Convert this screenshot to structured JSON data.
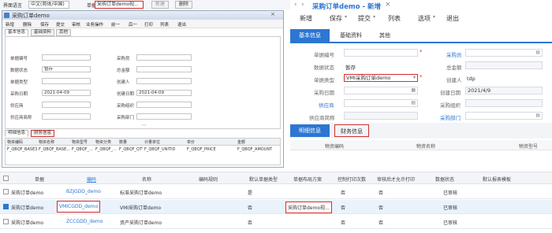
{
  "topbar": {
    "lang_label": "界面语言",
    "lang_value": "中文(简体/中国)",
    "template_label": "单据",
    "template_value": "采购订单demo视...",
    "new_btn": "新建",
    "delete_btn": "删除"
  },
  "oldwin": {
    "title": "采购订单demo",
    "toolbar": [
      "新增",
      "删除",
      "保存",
      "提交",
      "审核",
      "业务操作",
      "前一",
      "后一",
      "打印",
      "列表",
      "退出"
    ],
    "tabs": [
      "基本信息",
      "基础资料",
      "其他"
    ],
    "fields": {
      "bill_no": "单据编号",
      "doc_status": "数据状态",
      "doc_status_value": "暂存",
      "bill_type": "单据类型",
      "date": "采购日期",
      "date_value": "2021-04-09",
      "supplier": "供应商",
      "supplier_name": "供应商简称",
      "buyer": "采购员",
      "amount": "总金额",
      "creator": "创建人",
      "create_date": "创建日期",
      "create_date_value": "2021-04-09",
      "purchase_org": "采购组织",
      "purchase_dept": "采购部门"
    },
    "bottom_tabs": [
      "明细信息",
      "财务信息"
    ],
    "grid_headers": [
      "物资编码",
      "物资名称",
      "物资型号",
      "物资分类",
      "数量",
      "计量单位",
      "单价",
      "金额"
    ],
    "grid_row": [
      "F_QBQF_BASE3",
      "F_QBQF_BASE...",
      "F_QBQF_...",
      "F_QBQF_...",
      "F_QBQF_QTY",
      "F_QBQF_UNITID",
      "F_QBQF_PRICE",
      "F_QBQF_AMOUNT"
    ]
  },
  "newwin": {
    "title": "采购订单demo - 新增",
    "toolbar": [
      "新增",
      "保存",
      "提交",
      "列表",
      "选项",
      "退出"
    ],
    "tabs": [
      "基本信息",
      "基础资料",
      "其他"
    ],
    "fields": {
      "bill_no": "单据编号",
      "doc_status": "数据状态",
      "doc_status_value": "暂存",
      "bill_type": "单据类型",
      "bill_type_value": "VMI采购订单demo",
      "date": "采购日期",
      "supplier": "供应商",
      "supplier_name": "供应商简称",
      "buyer": "采购员",
      "amount": "总金额",
      "creator": "创建人",
      "creator_value": "tdp",
      "create_date": "创建日期",
      "create_date_value": "2021/4/9",
      "purchase_org": "采购组织",
      "purchase_dept": "采购部门"
    },
    "bottom_tabs": [
      "明细信息",
      "财务信息"
    ],
    "grid_headers": [
      "物资编码",
      "物资名称",
      "物资型号"
    ]
  },
  "list": {
    "headers": [
      "单据",
      "编码",
      "名称",
      "编码规则",
      "默认单据类型",
      "单据布局方案",
      "控制打印次数",
      "审核后才允许打印",
      "数据状态",
      "默认报表模板"
    ],
    "rows": [
      {
        "bill": "采购订单demo",
        "code": "BZJGDD_demo",
        "name": "标准采购订单demo",
        "default_type": "是",
        "layout": "",
        "ctrl_print": "否",
        "audit_print": "否",
        "status": "已审核"
      },
      {
        "bill": "采购订单demo",
        "code": "VMICGDD_demo",
        "name": "VMI采购订单demo",
        "default_type": "否",
        "layout": "采购订单demo视...",
        "ctrl_print": "否",
        "audit_print": "否",
        "status": "已审核"
      },
      {
        "bill": "采购订单demo",
        "code": "ZCCGDD_demo",
        "name": "资产采购订单demo",
        "default_type": "否",
        "layout": "",
        "ctrl_print": "否",
        "audit_print": "否",
        "status": "已审核"
      }
    ]
  },
  "colors": {
    "accent": "#2d76d2",
    "highlight": "#d32f2f",
    "selected_row": "#eaf2fc"
  }
}
